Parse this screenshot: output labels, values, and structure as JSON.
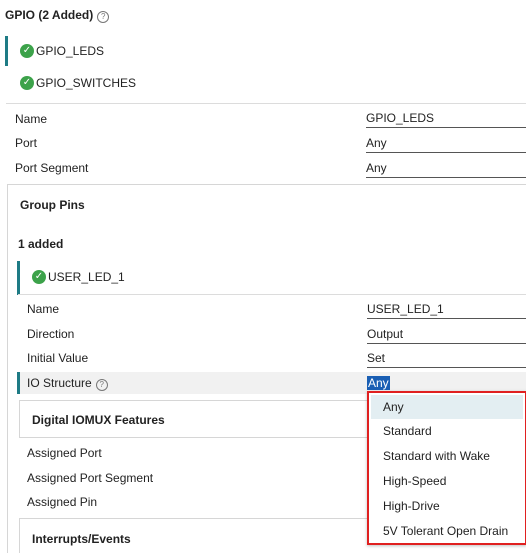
{
  "header": {
    "title": "GPIO (2 Added)",
    "help_icon": "question-circle-icon"
  },
  "gpio_items": [
    {
      "label": "GPIO_LEDS",
      "icon": "check-circle-icon",
      "selected": true
    },
    {
      "label": "GPIO_SWITCHES",
      "icon": "check-circle-icon",
      "selected": false
    }
  ],
  "gpio_fields": [
    {
      "label": "Name",
      "value": "GPIO_LEDS"
    },
    {
      "label": "Port",
      "value": "Any"
    },
    {
      "label": "Port Segment",
      "value": "Any"
    }
  ],
  "group_pins": {
    "title": "Group Pins",
    "count_text": "1 added",
    "pin": {
      "label": "USER_LED_1",
      "icon": "check-circle-icon"
    },
    "fields": [
      {
        "label": "Name",
        "value": "USER_LED_1"
      },
      {
        "label": "Direction",
        "value": "Output"
      },
      {
        "label": "Initial Value",
        "value": "Set"
      },
      {
        "label": "IO Structure",
        "value": "Any"
      }
    ],
    "digital_title": "Digital IOMUX Features",
    "assigned": [
      {
        "label": "Assigned Port"
      },
      {
        "label": "Assigned Port Segment"
      },
      {
        "label": "Assigned Pin"
      }
    ],
    "interrupts_title": "Interrupts/Events"
  },
  "io_structure_dropdown": {
    "options": [
      "Any",
      "Standard",
      "Standard with Wake",
      "High-Speed",
      "High-Drive",
      "5V Tolerant Open Drain"
    ],
    "highlighted": "Any",
    "border_color": "#e02020"
  },
  "colors": {
    "accent_marker": "#1e7b85",
    "check_green": "#3ca24a",
    "selection_blue": "#1a5fb4"
  }
}
